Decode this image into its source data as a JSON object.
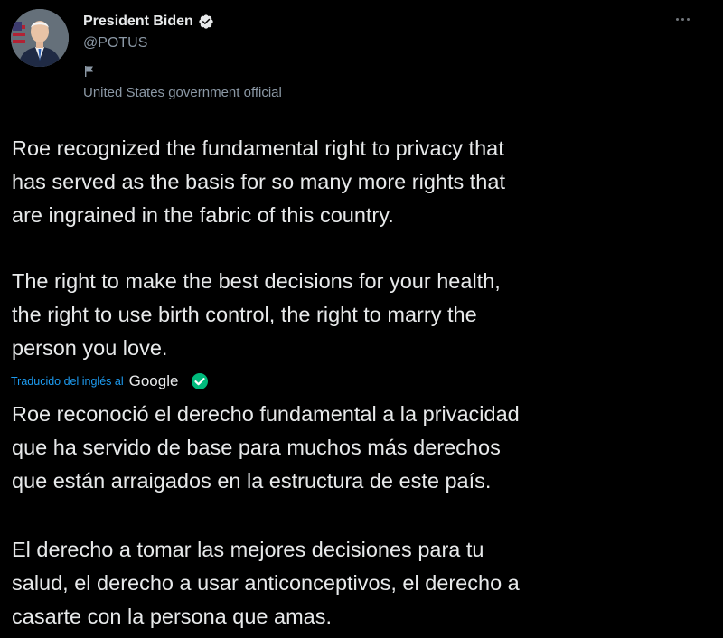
{
  "author": {
    "display_name": "President Biden",
    "handle": "@POTUS",
    "label": "United States government official"
  },
  "icons": {
    "verified": "verified-badge-icon",
    "flag": "flag-icon",
    "more": "more-options-icon",
    "translation_check": "check-badge-icon"
  },
  "tweet": {
    "paragraphs": [
      "Roe recognized the fundamental right to privacy that\nhas served as the basis for so many more rights that\nare ingrained in the fabric of this country.",
      "The right to make the best decisions for your health,\nthe right to use birth control, the right to marry the\nperson you love."
    ]
  },
  "translation": {
    "label": "Traducido del inglés al",
    "provider": "Google",
    "paragraphs": [
      "Roe reconoció el derecho fundamental a la privacidad\nque ha servido de base para muchos más derechos\nque están arraigados en la estructura de este país.",
      " El derecho a tomar las mejores decisiones para tu\nsalud, el derecho a usar anticonceptivos, el derecho a\ncasarte con la persona que amas."
    ]
  },
  "colors": {
    "background": "#000000",
    "text": "#e7e9ea",
    "secondary_text": "#8b98a5",
    "link": "#1d9bf0",
    "verified": "#1d9bf0",
    "check_badge": "#00ba7c"
  }
}
